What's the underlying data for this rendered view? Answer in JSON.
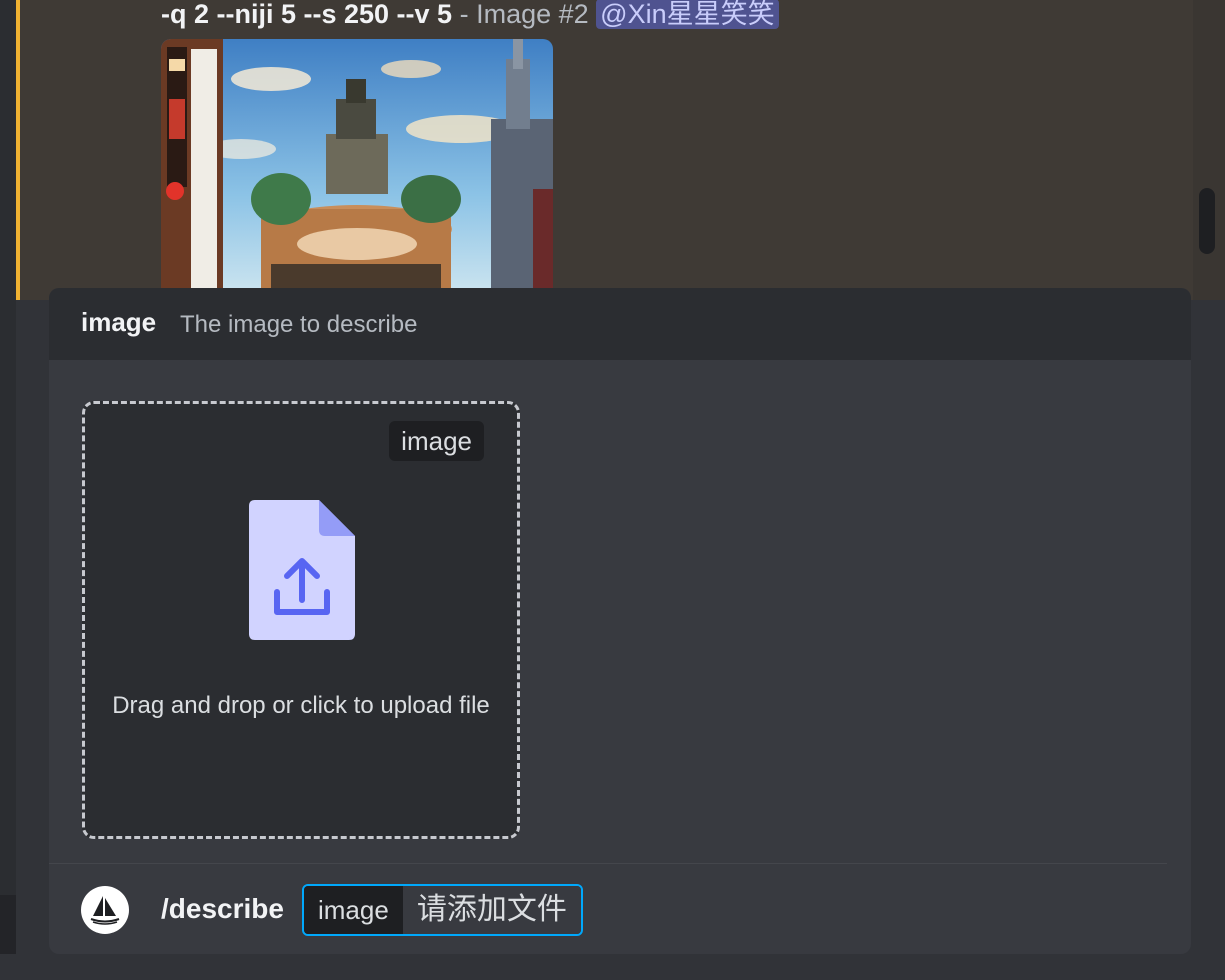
{
  "message": {
    "prompt_tail": "-q 2 --niji 5 --s 250 --v 5",
    "separator": " - ",
    "image_label": "Image #2",
    "mention": "@Xin星星笑笑"
  },
  "option_popup": {
    "option_name": "image",
    "option_description": "The image to describe",
    "dropzone": {
      "tag_label": "image",
      "instruction": "Drag and drop or click to upload file",
      "icon": "file-upload-icon"
    }
  },
  "command_bar": {
    "bot_avatar_icon": "midjourney-boat-icon",
    "command": "/describe",
    "param_name": "image",
    "param_value": "请添加文件"
  },
  "colors": {
    "accent_mention": "#f0b232",
    "chip_border": "#00a8fc",
    "file_icon": "#d1d3ff",
    "upload_arrow": "#5865f2"
  }
}
